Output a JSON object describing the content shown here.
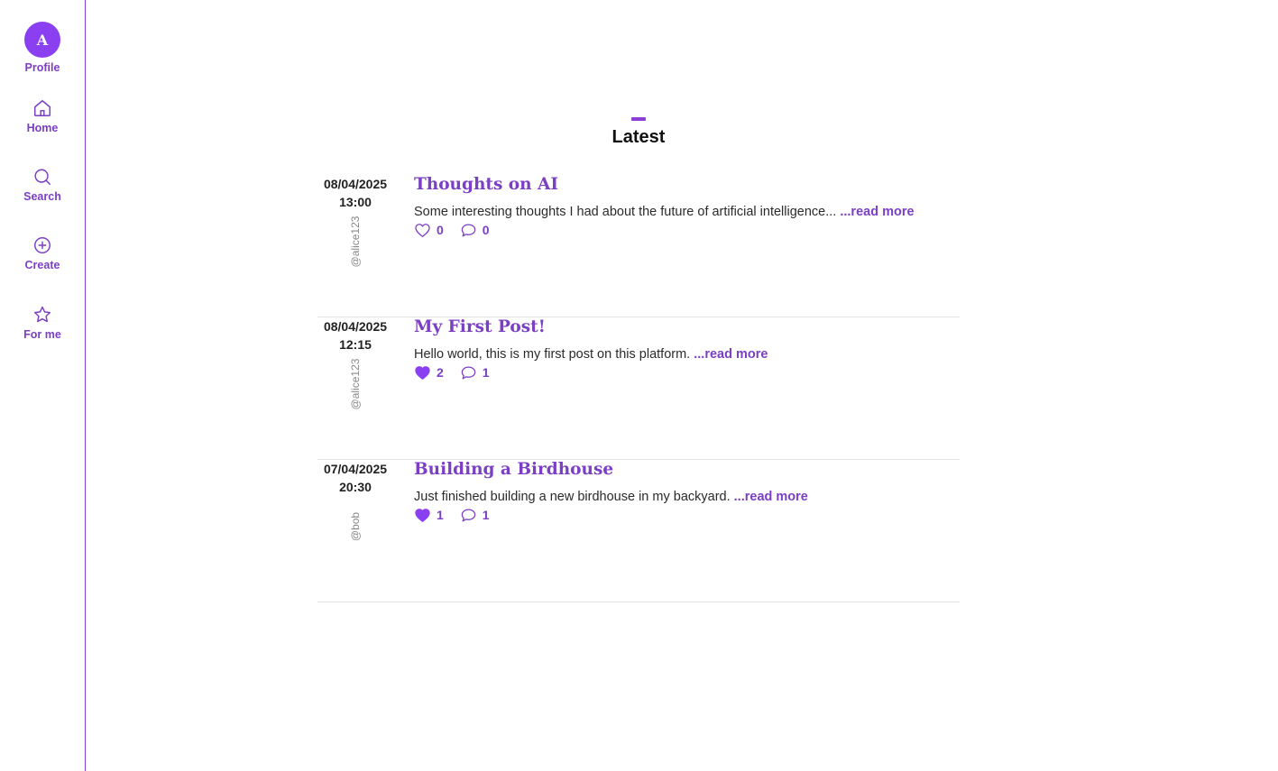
{
  "sidebar": {
    "items": [
      {
        "label": "Profile",
        "avatar_letter": "A"
      },
      {
        "label": "Home",
        "icon": "home-icon"
      },
      {
        "label": "Search",
        "icon": "search-icon"
      },
      {
        "label": "Create",
        "icon": "plus-circle-icon"
      },
      {
        "label": "For me",
        "icon": "star-icon"
      }
    ]
  },
  "feed": {
    "title": "Latest",
    "accent_color": "#8b3fd6",
    "posts": [
      {
        "date": "08/04/2025",
        "time": "13:00",
        "author": "@alice123",
        "title": "Thoughts on AI",
        "excerpt": "Some interesting thoughts I had about the future of artificial intelligence...",
        "read_more": "...read more",
        "likes": "0",
        "liked": false,
        "comments": "0"
      },
      {
        "date": "08/04/2025",
        "time": "12:15",
        "author": "@alice123",
        "title": "My First Post!",
        "excerpt": "Hello world, this is my first post on this platform.",
        "read_more": "...read more",
        "likes": "2",
        "liked": true,
        "comments": "1"
      },
      {
        "date": "07/04/2025",
        "time": "20:30",
        "author": "@bob",
        "title": "Building a Birdhouse",
        "excerpt": "Just finished building a new birdhouse in my backyard.",
        "read_more": "...read more",
        "likes": "1",
        "liked": true,
        "comments": "1"
      }
    ]
  }
}
